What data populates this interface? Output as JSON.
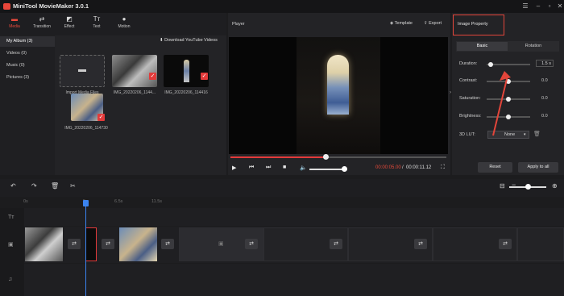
{
  "app": {
    "title": "MiniTool MovieMaker 3.0.1"
  },
  "media_tabs": [
    {
      "label": "Media",
      "icon": "folder-icon",
      "glyph": "▬"
    },
    {
      "label": "Transition",
      "icon": "transition-icon",
      "glyph": "⇄"
    },
    {
      "label": "Effect",
      "icon": "effect-icon",
      "glyph": "◩"
    },
    {
      "label": "Text",
      "icon": "text-icon",
      "glyph": "Tт"
    },
    {
      "label": "Motion",
      "icon": "motion-icon",
      "glyph": "●"
    }
  ],
  "albums": [
    {
      "label": "My Album (3)"
    },
    {
      "label": "Videos (0)"
    },
    {
      "label": "Music (0)"
    },
    {
      "label": "Pictures (3)"
    }
  ],
  "download_youtube": "Download YouTube Videos",
  "media_items": [
    {
      "label": "Import Media Files"
    },
    {
      "label": "IMG_20220206_1144..."
    },
    {
      "label": "IMG_20220206_114416"
    },
    {
      "label": "IMG_20220206_114730"
    }
  ],
  "player": {
    "label": "Player",
    "template": "Template",
    "export": "Export",
    "time_current": "00:00:05.00",
    "time_separator": "/",
    "time_total": "00:00:11.12",
    "progress": 0.44,
    "volume": 0.95
  },
  "property": {
    "title": "Image Property",
    "tabs": [
      "Basic",
      "Rotation"
    ],
    "duration_label": "Duration:",
    "duration_value": "1.5 s",
    "contrast_label": "Contrast:",
    "contrast_value": "0.0",
    "saturation_label": "Saturation:",
    "saturation_value": "0.0",
    "brightness_label": "Brightness:",
    "brightness_value": "0.0",
    "lut_label": "3D LUT:",
    "lut_value": "None",
    "reset": "Reset",
    "apply_all": "Apply to all"
  },
  "timeline": {
    "ticks": [
      "0s",
      "5s",
      "6.5s",
      "11.5s"
    ],
    "zoom": 0.5
  },
  "colors": {
    "accent": "#e33a3a",
    "playhead": "#3b84f0",
    "annotation": "#e2453a"
  }
}
